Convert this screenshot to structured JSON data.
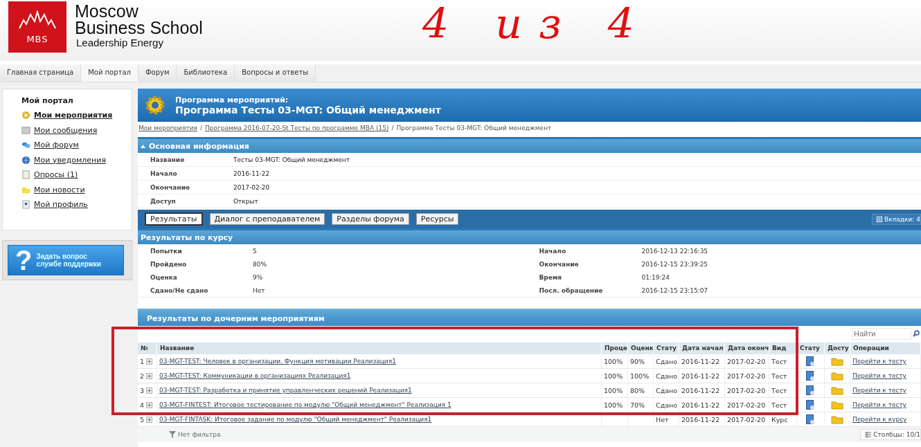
{
  "header": {
    "logo_text": "MBS",
    "brand_line1": "Moscow",
    "brand_line2": "Business School",
    "tagline": "Leadership Energy"
  },
  "annotation": {
    "text": "4 из 4"
  },
  "nav_tabs": [
    {
      "label": "Главная страница",
      "selected": false
    },
    {
      "label": "Мой портал",
      "selected": true
    },
    {
      "label": "Форум",
      "selected": false
    },
    {
      "label": "Библиотека",
      "selected": false
    },
    {
      "label": "Вопросы и ответы",
      "selected": false
    }
  ],
  "sidebar": {
    "title": "Мой портал",
    "items": [
      {
        "label": "Мои мероприятия",
        "kind": "gear",
        "selected": true
      },
      {
        "label": "Мои сообщения",
        "kind": "message",
        "selected": false
      },
      {
        "label": "Мой форум",
        "kind": "forum",
        "selected": false
      },
      {
        "label": "Мои уведомления",
        "kind": "notify",
        "selected": false
      },
      {
        "label": "Опросы (1)",
        "kind": "poll",
        "selected": false
      },
      {
        "label": "Мои новости",
        "kind": "news",
        "selected": false
      },
      {
        "label": "Мой профиль",
        "kind": "profile",
        "selected": false
      }
    ]
  },
  "help_button": {
    "icon_char": "?",
    "line1": "Задать вопрос",
    "line2": "службе поддержки"
  },
  "page_title": {
    "subtitle": "Программа мероприятий:",
    "title": "Программа Тесты 03-MGT: Общий менеджмент"
  },
  "breadcrumb": [
    {
      "label": "Мои мероприятия",
      "kind": "link"
    },
    {
      "label": "/",
      "kind": "separator"
    },
    {
      "label": "Программа 2016-07-20-St Тесты по программе MBA (15)",
      "kind": "link"
    },
    {
      "label": "/",
      "kind": "separator"
    },
    {
      "label": "Программа Тесты 03-MGT: Общий менеджмент",
      "kind": "current"
    }
  ],
  "main_info": {
    "title": "Основная информация",
    "expanded": true,
    "fields": [
      {
        "label": "Название",
        "value": "Тесты 03-MGT: Общий менеджмент"
      },
      {
        "label": "Начало",
        "value": "2016-11-22"
      },
      {
        "label": "Окончание",
        "value": "2017-02-20"
      },
      {
        "label": "Доступ",
        "value": "Открыт"
      }
    ]
  },
  "sub_tabs": [
    {
      "label": "Результаты",
      "selected": true
    },
    {
      "label": "Диалог с преподавателем",
      "selected": false
    },
    {
      "label": "Разделы форума",
      "selected": false
    },
    {
      "label": "Ресурсы",
      "selected": false
    }
  ],
  "tabs_counter": "Вкладки: 4",
  "course_results": {
    "title": "Результаты по курсу",
    "left": [
      {
        "label": "Попытки",
        "value": "5"
      },
      {
        "label": "Пройдено",
        "value": "80%"
      },
      {
        "label": "Оценка",
        "value": "9%"
      },
      {
        "label": "Сдано/Не сдано",
        "value": "Нет"
      }
    ],
    "right": [
      {
        "label": "Начало",
        "value": "2016-12-13 22:16:35"
      },
      {
        "label": "Окончание",
        "value": "2016-12-15 23:39:25"
      },
      {
        "label": "Время",
        "value": "01:19:24"
      },
      {
        "label": "Посл. обращение",
        "value": "2016-12-15 23:15:07"
      }
    ]
  },
  "child_results": {
    "title": "Результаты по дочерним мероприятиям",
    "search": {
      "placeholder": "Найти"
    },
    "columns": [
      "№",
      "Название",
      "Проце",
      "Оценк",
      "Стату",
      "Дата начал",
      "Дата оконч",
      "Вид",
      "Стату",
      "Досту",
      "Операции"
    ],
    "rows": [
      {
        "number": "1",
        "name": "03-MGT-TEST: Человек в организации. Функция мотивации Реализация1",
        "percent": "100%",
        "score": "90%",
        "status": "Сдано",
        "start": "2016-11-22",
        "end": "2017-02-20",
        "type": "Тест",
        "operation": "Перейти к тесту"
      },
      {
        "number": "2",
        "name": "03-MGT-TEST: Коммуникации в организациях Реализация1",
        "percent": "100%",
        "score": "100%",
        "status": "Сдано",
        "start": "2016-11-22",
        "end": "2017-02-20",
        "type": "Тест",
        "operation": "Перейти к тесту"
      },
      {
        "number": "3",
        "name": "03-MGT-TEST: Разработка и принятие управленческих решений Реализация1",
        "percent": "100%",
        "score": "80%",
        "status": "Сдано",
        "start": "2016-11-22",
        "end": "2017-02-20",
        "type": "Тест",
        "operation": "Перейти к тесту"
      },
      {
        "number": "4",
        "name": "03-MGT-FINTEST: Итоговое тестирование по модулю \"Общий менеджмент\" Реализация 1",
        "percent": "100%",
        "score": "70%",
        "status": "Сдано",
        "start": "2016-11-22",
        "end": "2017-02-20",
        "type": "Тест",
        "operation": "Перейти к тесту"
      },
      {
        "number": "5",
        "name": "03-MGT-FINTASK: Итоговое задание по модулю \"Общий менеджмент\" Реализация1",
        "status": "Нет",
        "start": "2016-11-22",
        "end": "2017-02-20",
        "type": "Курс",
        "operation": "Перейти к курсу"
      }
    ],
    "filter": "Нет фильтра",
    "columns_counter": "Столбцы: 10/1"
  }
}
